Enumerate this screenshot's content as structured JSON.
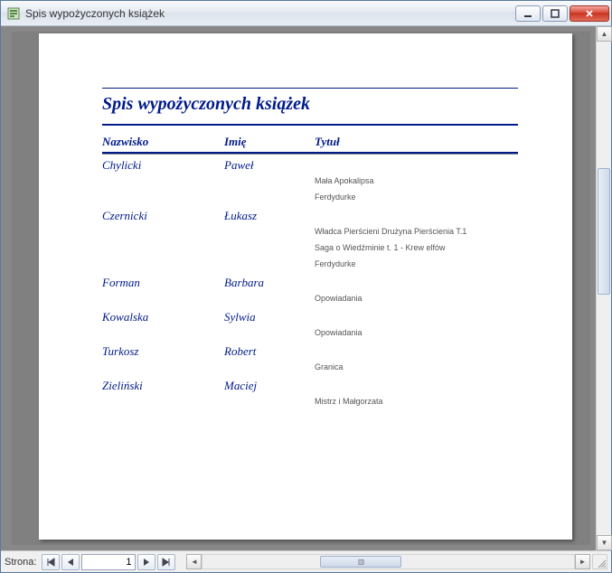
{
  "window": {
    "title": "Spis wypożyczonych książek"
  },
  "report": {
    "title": "Spis wypożyczonych książek",
    "headers": {
      "surname": "Nazwisko",
      "name": "Imię",
      "book_title": "Tytuł"
    },
    "groups": [
      {
        "surname": "Chylicki",
        "name": "Paweł",
        "books": [
          "Mała Apokalipsa",
          "Ferdydurke"
        ]
      },
      {
        "surname": "Czernicki",
        "name": "Łukasz",
        "books": [
          "Władca Pierścieni Drużyna Pierścienia T.1",
          "Saga o Wiedźminie t. 1 - Krew elfów",
          "Ferdydurke"
        ]
      },
      {
        "surname": "Forman",
        "name": "Barbara",
        "books": [
          "Opowiadania"
        ]
      },
      {
        "surname": "Kowalska",
        "name": "Sylwia",
        "books": [
          "Opowiadania"
        ]
      },
      {
        "surname": "Turkosz",
        "name": "Robert",
        "books": [
          "Granica"
        ]
      },
      {
        "surname": "Zieliński",
        "name": "Maciej",
        "books": [
          "Mistrz i Małgorzata"
        ]
      }
    ]
  },
  "navigation": {
    "label": "Strona:",
    "page_value": "1"
  }
}
